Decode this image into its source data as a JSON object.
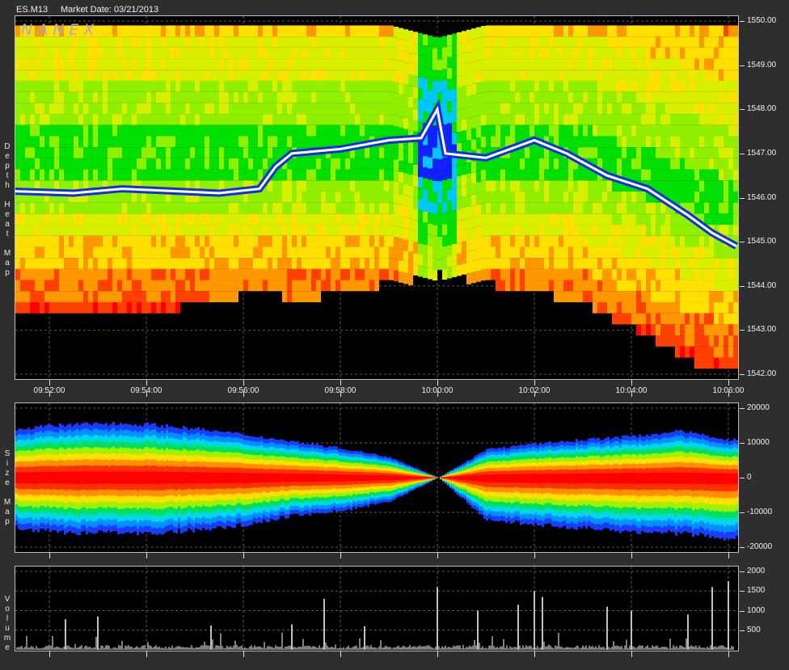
{
  "header": {
    "symbol": "ES.M13",
    "market_date_label": "Market Date: 03/21/2013"
  },
  "watermark": "NANEX",
  "colors": {
    "background": "#000000",
    "frame": "#2e2e2e",
    "grid": "#5a5a5a",
    "trade_line": "#ffffff",
    "best_bid_ask": "#1030e0"
  },
  "chart_data": [
    {
      "type": "heatmap",
      "label": "Depth Heat Map",
      "x_tick_labels": [
        "09:52:00",
        "09:54:00",
        "09:56:00",
        "09:58:00",
        "10:00:00",
        "10:02:00",
        "10:04:00",
        "10:06:00"
      ],
      "y_tick_labels": [
        "1550.00",
        "1549.00",
        "1548.00",
        "1547.00",
        "1546.00",
        "1545.00",
        "1544.00",
        "1543.00",
        "1542.00"
      ],
      "ylim": [
        1542.0,
        1550.0
      ],
      "colorscale": [
        "#1020ff",
        "#00c8ff",
        "#00e000",
        "#90f000",
        "#d8f000",
        "#ffe000",
        "#ff9800",
        "#ff4000",
        "#ff0000"
      ],
      "price_line": [
        {
          "t": "09:51:10",
          "p": 1546.15
        },
        {
          "t": "09:52:30",
          "p": 1546.1
        },
        {
          "t": "09:53:30",
          "p": 1546.2
        },
        {
          "t": "09:54:30",
          "p": 1546.15
        },
        {
          "t": "09:55:30",
          "p": 1546.1
        },
        {
          "t": "09:56:20",
          "p": 1546.2
        },
        {
          "t": "09:56:40",
          "p": 1546.7
        },
        {
          "t": "09:57:00",
          "p": 1547.0
        },
        {
          "t": "09:58:00",
          "p": 1547.1
        },
        {
          "t": "09:59:00",
          "p": 1547.3
        },
        {
          "t": "09:59:40",
          "p": 1547.35
        },
        {
          "t": "10:00:00",
          "p": 1548.0
        },
        {
          "t": "10:00:10",
          "p": 1547.0
        },
        {
          "t": "10:01:00",
          "p": 1546.9
        },
        {
          "t": "10:02:00",
          "p": 1547.3
        },
        {
          "t": "10:02:40",
          "p": 1547.0
        },
        {
          "t": "10:03:30",
          "p": 1546.5
        },
        {
          "t": "10:04:20",
          "p": 1546.2
        },
        {
          "t": "10:05:10",
          "p": 1545.6
        },
        {
          "t": "10:05:40",
          "p": 1545.2
        },
        {
          "t": "10:06:10",
          "p": 1544.9
        }
      ]
    },
    {
      "type": "area",
      "label": "Size Map",
      "y_tick_labels": [
        "20000",
        "10000",
        "0",
        "-10000",
        "-20000"
      ],
      "ylim": [
        -20000,
        20000
      ],
      "x": [
        "09:51:00",
        "09:52:00",
        "09:53:00",
        "09:54:00",
        "09:55:00",
        "09:56:00",
        "09:57:00",
        "09:58:00",
        "09:59:00",
        "10:00:00",
        "10:01:00",
        "10:02:00",
        "10:03:00",
        "10:04:00",
        "10:05:00",
        "10:06:00"
      ],
      "bid_size": [
        13800,
        15000,
        15800,
        15500,
        14200,
        12500,
        10500,
        8500,
        6000,
        0,
        8200,
        9800,
        11000,
        12000,
        13500,
        11000
      ],
      "ask_size": [
        -14000,
        -15500,
        -16000,
        -16000,
        -15000,
        -13500,
        -11000,
        -9500,
        -7000,
        0,
        -12000,
        -13500,
        -14500,
        -15500,
        -16000,
        -17500
      ]
    },
    {
      "type": "bar",
      "label": "Volume",
      "y_tick_labels": [
        "2000",
        "1500",
        "1000",
        "500"
      ],
      "ylim": [
        0,
        2000
      ],
      "spikes": [
        {
          "t": "09:51:10",
          "v": 700
        },
        {
          "t": "09:52:20",
          "v": 780
        },
        {
          "t": "09:53:00",
          "v": 850
        },
        {
          "t": "09:55:20",
          "v": 620
        },
        {
          "t": "09:57:00",
          "v": 650
        },
        {
          "t": "09:57:40",
          "v": 1300
        },
        {
          "t": "09:58:30",
          "v": 600
        },
        {
          "t": "10:00:00",
          "v": 1600
        },
        {
          "t": "10:00:50",
          "v": 1000
        },
        {
          "t": "10:01:40",
          "v": 1150
        },
        {
          "t": "10:02:00",
          "v": 1500
        },
        {
          "t": "10:02:10",
          "v": 1350
        },
        {
          "t": "10:03:30",
          "v": 1100
        },
        {
          "t": "10:04:00",
          "v": 1000
        },
        {
          "t": "10:05:10",
          "v": 900
        },
        {
          "t": "10:05:40",
          "v": 1600
        },
        {
          "t": "10:06:00",
          "v": 1750
        }
      ]
    }
  ]
}
